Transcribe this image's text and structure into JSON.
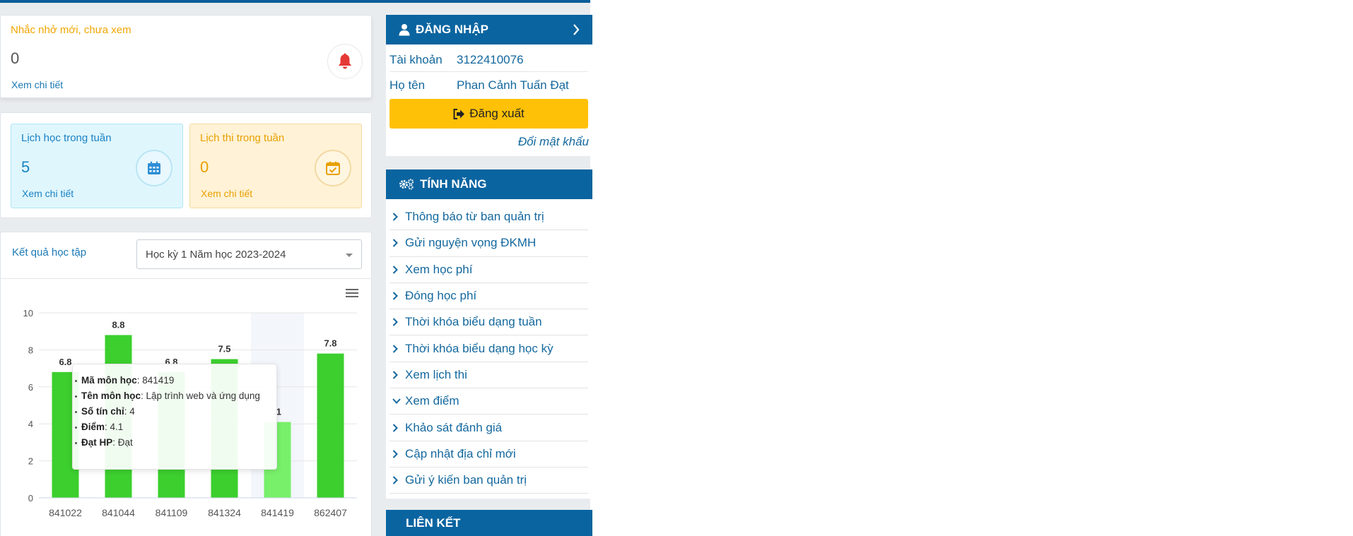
{
  "reminder": {
    "title": "Nhắc nhở mới, chưa xem",
    "count": "0",
    "link": "Xem chi tiết",
    "icon": "bell-icon",
    "icon_color": "#e53935"
  },
  "study_week": {
    "title": "Lịch học trong tuần",
    "count": "5",
    "link": "Xem chi tiết",
    "icon": "calendar-icon"
  },
  "exam_week": {
    "title": "Lịch thi trong tuần",
    "count": "0",
    "link": "Xem chi tiết",
    "icon": "calendar-check-icon"
  },
  "results": {
    "label": "Kết quả học tập",
    "semester_select": "Học kỳ 1 Năm học 2023-2024",
    "menu_icon": "hamburger-icon"
  },
  "chart_data": {
    "type": "bar",
    "categories": [
      "841022",
      "841044",
      "841109",
      "841324",
      "841419",
      "862407"
    ],
    "values": [
      6.8,
      8.8,
      6.8,
      7.5,
      4.1,
      7.8
    ],
    "value_labels": [
      "6.8",
      "8.8",
      "6.8",
      "7.5",
      ".1",
      "7.8"
    ],
    "yticks": [
      "0",
      "2",
      "4",
      "6",
      "8",
      "10"
    ],
    "ylim": [
      0,
      10
    ],
    "grid": true,
    "bar_color": "#3ccf2e",
    "highlight_color": "#78f06a",
    "highlight_index": 4
  },
  "tooltip": {
    "rows": [
      {
        "k": "Mã môn học",
        "v": "841419"
      },
      {
        "k": "Tên môn học",
        "v": "Lập trình web và ứng dụng"
      },
      {
        "k": "Số tín chỉ",
        "v": "4"
      },
      {
        "k": "Điểm",
        "v": "4.1"
      },
      {
        "k": "Đạt HP",
        "v": "Đạt"
      }
    ]
  },
  "login": {
    "title": "ĐĂNG NHẬP",
    "account_label": "Tài khoản",
    "account_value": "3122410076",
    "name_label": "Họ tên",
    "name_value": "Phan Cảnh Tuấn Đạt",
    "logout": "Đăng xuất",
    "change_password": "Đổi mật khẩu"
  },
  "features": {
    "title": "TÍNH NĂNG",
    "items": [
      {
        "label": "Thông báo từ ban quản trị",
        "expanded": false
      },
      {
        "label": "Gửi nguyện vọng ĐKMH",
        "expanded": false
      },
      {
        "label": "Xem học phí",
        "expanded": false
      },
      {
        "label": "Đóng học phí",
        "expanded": false
      },
      {
        "label": "Thời khóa biểu dạng tuần",
        "expanded": false
      },
      {
        "label": "Thời khóa biểu dạng học kỳ",
        "expanded": false
      },
      {
        "label": "Xem lịch thi",
        "expanded": false
      },
      {
        "label": "Xem điểm",
        "expanded": true
      },
      {
        "label": "Khảo sát đánh giá",
        "expanded": false
      },
      {
        "label": "Cập nhật địa chỉ mới",
        "expanded": false
      },
      {
        "label": "Gửi ý kiến ban quản trị",
        "expanded": false
      }
    ]
  },
  "links": {
    "title": "LIÊN KẾT"
  },
  "colors": {
    "header_blue": "#0a64a0",
    "link_blue": "#14689e",
    "logout_yellow": "#ffc107"
  }
}
